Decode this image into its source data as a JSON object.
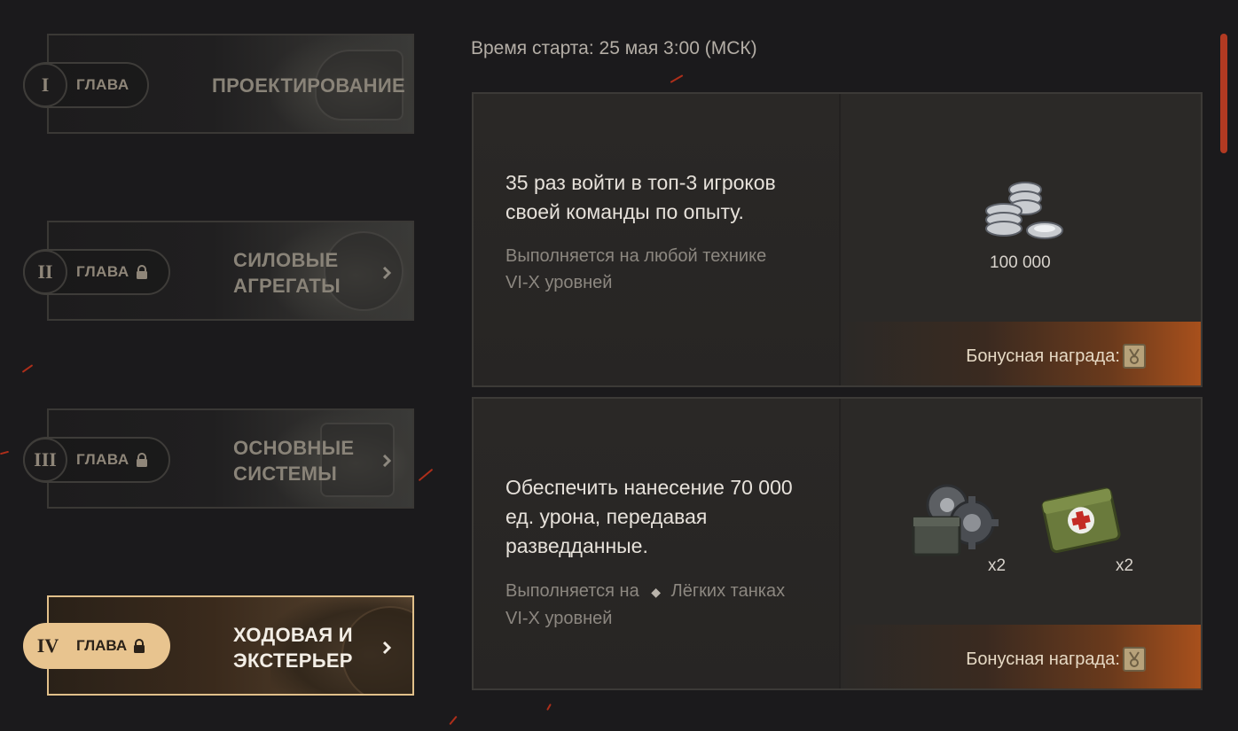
{
  "chapters": [
    {
      "roman": "I",
      "label": "ГЛАВА",
      "title_lines": [
        "ПРОЕКТИРОВАНИЕ"
      ],
      "locked": false,
      "active": false
    },
    {
      "roman": "II",
      "label": "ГЛАВА",
      "title_lines": [
        "СИЛОВЫЕ",
        "АГРЕГАТЫ"
      ],
      "locked": true,
      "active": false
    },
    {
      "roman": "III",
      "label": "ГЛАВА",
      "title_lines": [
        "ОСНОВНЫЕ",
        "СИСТЕМЫ"
      ],
      "locked": true,
      "active": false
    },
    {
      "roman": "IV",
      "label": "ГЛАВА",
      "title_lines": [
        "ХОДОВАЯ И",
        "ЭКСТЕРЬЕР"
      ],
      "locked": true,
      "active": true
    }
  ],
  "start_time": "Время старта: 25 мая 3:00 (МСК)",
  "quests": [
    {
      "description_lines": [
        "35 раз войти в топ-3 игроков",
        "своей команды по опыту."
      ],
      "condition_lines": [
        "Выполняется на любой технике",
        "VI-X уровней"
      ],
      "rewards": [
        {
          "icon": "silver-coins-icon",
          "label": "100 000"
        }
      ],
      "bonus_label": "Бонусная награда:",
      "bonus_count": "1"
    },
    {
      "description_lines": [
        "Обеспечить нанесение 70 000",
        "ед. урона, передавая",
        "разведданные."
      ],
      "condition_prefix": "Выполняется на",
      "condition_vehicle": "Лёгких танках",
      "condition_level": "VI-X уровней",
      "rewards": [
        {
          "icon": "repair-kit-icon",
          "label": "x2"
        },
        {
          "icon": "first-aid-kit-icon",
          "label": "x2"
        }
      ],
      "bonus_label": "Бонусная награда:",
      "bonus_count": "1"
    }
  ],
  "colors": {
    "accent": "#e8c48f",
    "background": "#1b1a1c",
    "ember": "#c8331a"
  }
}
